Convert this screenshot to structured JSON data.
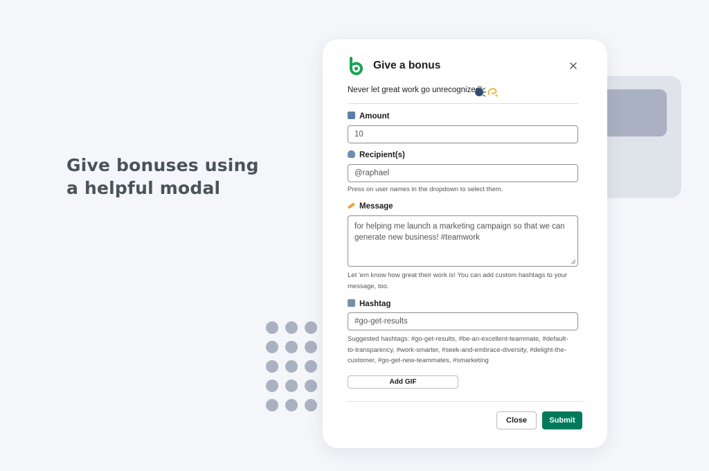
{
  "headline": "Give bonuses using a helpful modal",
  "modal": {
    "title": "Give a bonus",
    "intro": "Never let great work go unrecognized!",
    "amount": {
      "label": "Amount",
      "value": "10"
    },
    "recipients": {
      "label": "Recipient(s)",
      "value": "@raphael",
      "hint": "Press on user names in the dropdown to select them."
    },
    "message": {
      "label": "Message",
      "value": "for helping me launch a marketing campaign so that we can generate new business! #teamwork",
      "hint": "Let 'em know how great their work is! You can add custom hashtags to your message, too."
    },
    "hashtag": {
      "label": "Hashtag",
      "value": "#go-get-results",
      "hint": "Suggested hashtags: #go-get-results, #be-an-excellent-teammate, #default-to-transparency, #work-smarter, #seek-and-embrace-diversity, #delight-the-customer, #go-get-new-teammates, #smarketing"
    },
    "add_gif_label": "Add GIF",
    "close_label": "Close",
    "submit_label": "Submit"
  },
  "icons": {
    "logo": "bonusly-logo-icon",
    "close": "close-icon",
    "amount": "calculator-icon",
    "recipients": "person-icon",
    "message": "pencil-icon",
    "hashtag": "hash-icon",
    "intro_emoji": "speaking-head-and-dizzy-icon"
  },
  "colors": {
    "brand_green": "#1aa352",
    "submit_green": "#007a5a",
    "headline": "#4a5456",
    "background": "#f4f6f9"
  }
}
